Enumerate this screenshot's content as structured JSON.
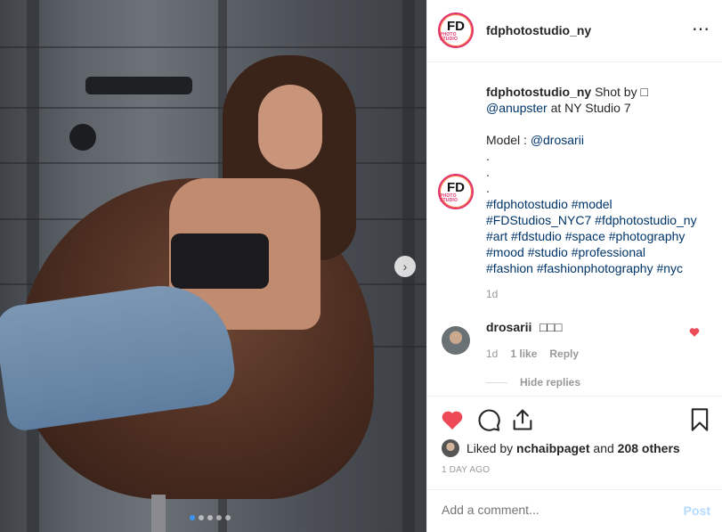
{
  "header": {
    "username": "fdphotostudio_ny",
    "avatar_text_main": "FD",
    "avatar_text_sub": "PHOTO STUDIO",
    "more_icon": "⋯"
  },
  "photo": {
    "next_icon": "›",
    "carousel_dots": 5,
    "carousel_active": 1
  },
  "caption": {
    "username": "fdphotostudio_ny",
    "shot_by": "Shot by □",
    "mention_photographer": "@anupster",
    "location": "at NY Studio 7",
    "model_label": "Model :",
    "mention_model": "@drosarii",
    "dot1": ".",
    "dot2": ".",
    "dot3": ".",
    "hashtags_line1": "#fdphotostudio #model",
    "hashtags_line2": "#FDStudios_NYC7 #fdphotostudio_ny",
    "hashtags_line3": "#art #fdstudio #space #photography",
    "hashtags_line4": "#mood #studio #professional",
    "hashtags_line5": "#fashion #fashionphotography #nyc",
    "time": "1d"
  },
  "reply": {
    "username": "drosarii",
    "text": "□□□",
    "time": "1d",
    "likes": "1 like",
    "reply_label": "Reply",
    "hide_replies": "Hide replies"
  },
  "actions": {
    "liked_by_prefix": "Liked by",
    "liked_by_user": "nchaibpaget",
    "liked_by_and": "and",
    "liked_by_others": "208 others",
    "posted": "1 DAY AGO"
  },
  "comment_box": {
    "placeholder": "Add a comment...",
    "post_label": "Post"
  },
  "colors": {
    "heart": "#ed4956",
    "link": "#003569",
    "post_disabled": "#b3dbff"
  }
}
